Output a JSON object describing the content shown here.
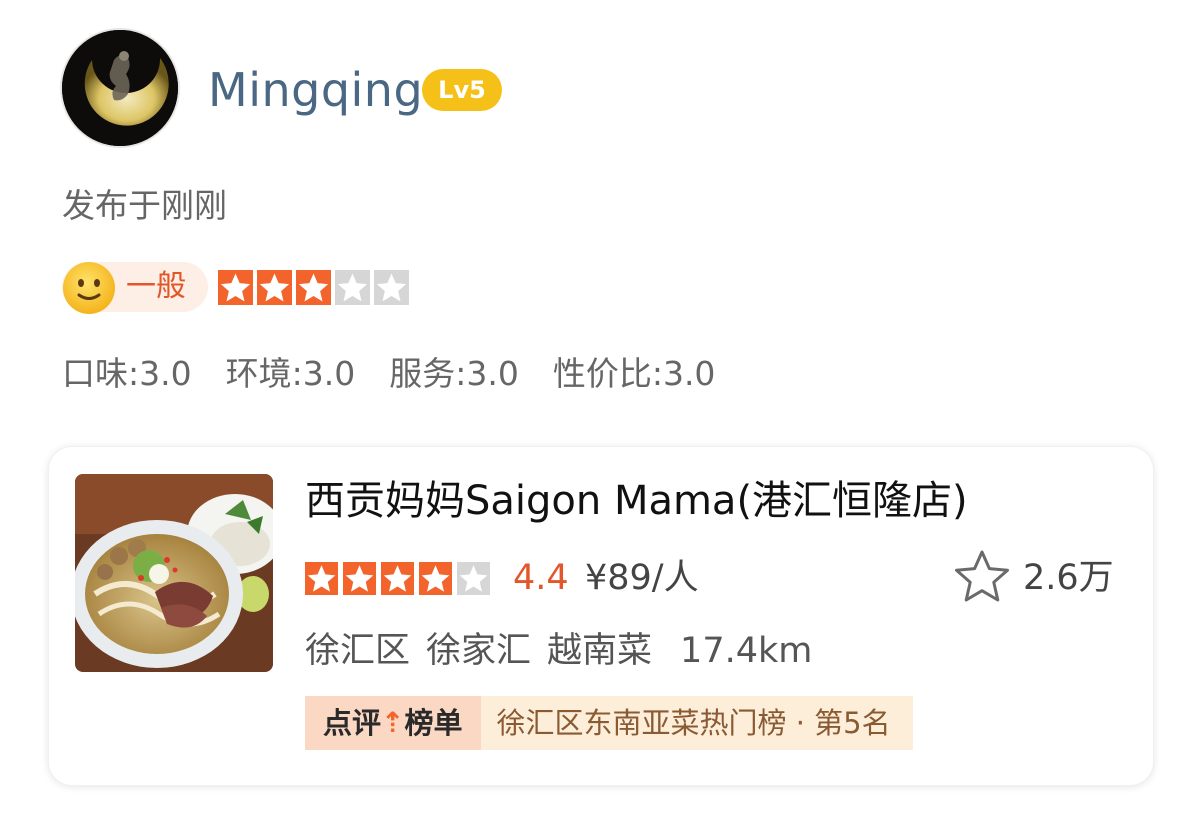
{
  "user": {
    "name": "Mingqing",
    "level": "Lv5",
    "post_time": "发布于刚刚"
  },
  "overall_rating": {
    "mood_label": "一般",
    "stars": 3,
    "max_stars": 5
  },
  "subscores": [
    {
      "label": "口味:3.0"
    },
    {
      "label": "环境:3.0"
    },
    {
      "label": "服务:3.0"
    },
    {
      "label": "性价比:3.0"
    }
  ],
  "shop": {
    "name": "西贡妈妈Saigon Mama(港汇恒隆店)",
    "stars": 4,
    "max_stars": 5,
    "score": "4.4",
    "price": "¥89/人",
    "favorites": "2.6万",
    "district": "徐汇区",
    "area": "徐家汇",
    "cuisine": "越南菜",
    "distance": "17.4km",
    "rank_brand_left": "点评",
    "rank_brand_right": "榜单",
    "rank_text": "徐汇区东南亚菜热门榜 · 第5名"
  },
  "icons": {
    "avatar": "crescent-moon-avatar",
    "mood": "neutral-smiley-icon",
    "favorite": "star-outline-icon",
    "rank_arrow": "up-arrow-icon"
  },
  "colors": {
    "accent": "#f2642b",
    "star_off": "#d6d6d6",
    "level_badge": "#f5c018",
    "username": "#4a6784"
  }
}
